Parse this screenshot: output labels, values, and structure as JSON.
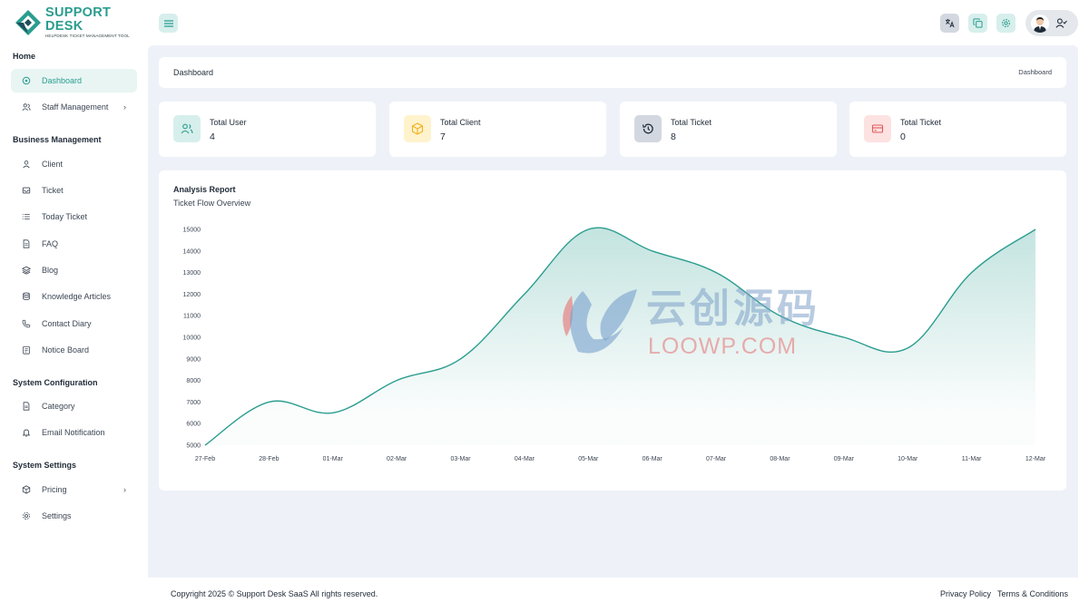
{
  "brand": {
    "title": "SUPPORT DESK",
    "subtitle": "HELPDESK TICKET MANAGEMENT TOOL"
  },
  "sidebar": {
    "sections": [
      {
        "title": "Home",
        "items": [
          {
            "label": "Dashboard",
            "icon": "dashboard-icon",
            "active": true
          },
          {
            "label": "Staff Management",
            "icon": "users-icon",
            "chevron": true
          }
        ]
      },
      {
        "title": "Business Management",
        "items": [
          {
            "label": "Client",
            "icon": "user-icon"
          },
          {
            "label": "Ticket",
            "icon": "inbox-icon"
          },
          {
            "label": "Today Ticket",
            "icon": "list-icon"
          },
          {
            "label": "FAQ",
            "icon": "document-icon"
          },
          {
            "label": "Blog",
            "icon": "layers-icon"
          },
          {
            "label": "Knowledge Articles",
            "icon": "database-icon"
          },
          {
            "label": "Contact Diary",
            "icon": "phone-icon"
          },
          {
            "label": "Notice Board",
            "icon": "clipboard-icon"
          }
        ]
      },
      {
        "title": "System Configuration",
        "items": [
          {
            "label": "Category",
            "icon": "file-icon"
          },
          {
            "label": "Email Notification",
            "icon": "bell-icon"
          }
        ]
      },
      {
        "title": "System Settings",
        "items": [
          {
            "label": "Pricing",
            "icon": "package-icon",
            "chevron": true
          },
          {
            "label": "Settings",
            "icon": "gear-icon"
          }
        ]
      }
    ]
  },
  "breadcrumb": {
    "title": "Dashboard",
    "current": "Dashboard"
  },
  "stats": [
    {
      "label": "Total User",
      "value": "4",
      "icon": "users-icon",
      "bg": "#d7efec",
      "fg": "#2a9d8f"
    },
    {
      "label": "Total Client",
      "value": "7",
      "icon": "box-icon",
      "bg": "#fff3cd",
      "fg": "#f2b01e"
    },
    {
      "label": "Total Ticket",
      "value": "8",
      "icon": "history-icon",
      "bg": "#d3d8e0",
      "fg": "#1f2a37"
    },
    {
      "label": "Total Ticket",
      "value": "0",
      "icon": "credit-card-icon",
      "bg": "#fde2e2",
      "fg": "#e05a5a"
    }
  ],
  "chart": {
    "title": "Analysis Report",
    "subtitle": "Ticket Flow Overview"
  },
  "chart_data": {
    "type": "area",
    "x": [
      "27-Feb",
      "28-Feb",
      "01-Mar",
      "02-Mar",
      "03-Mar",
      "04-Mar",
      "05-Mar",
      "06-Mar",
      "07-Mar",
      "08-Mar",
      "09-Mar",
      "10-Mar",
      "11-Mar",
      "12-Mar"
    ],
    "series": [
      {
        "values": [
          5000,
          7000,
          6500,
          8000,
          9000,
          12000,
          15000,
          14000,
          13000,
          11000,
          10000,
          9500,
          13000,
          15000
        ]
      }
    ],
    "ylim": [
      5000,
      15000
    ],
    "yticks": [
      15000,
      14000,
      13000,
      12000,
      11000,
      10000,
      9000,
      8000,
      7000,
      6000,
      5000
    ],
    "color": "#2a9d8f"
  },
  "watermark": {
    "cn": "云创源码",
    "en": "LOOWP.COM"
  },
  "footer": {
    "copyright": "Copyright 2025 © Support Desk SaaS All rights reserved.",
    "privacy": "Privacy Policy",
    "terms": "Terms & Conditions"
  }
}
